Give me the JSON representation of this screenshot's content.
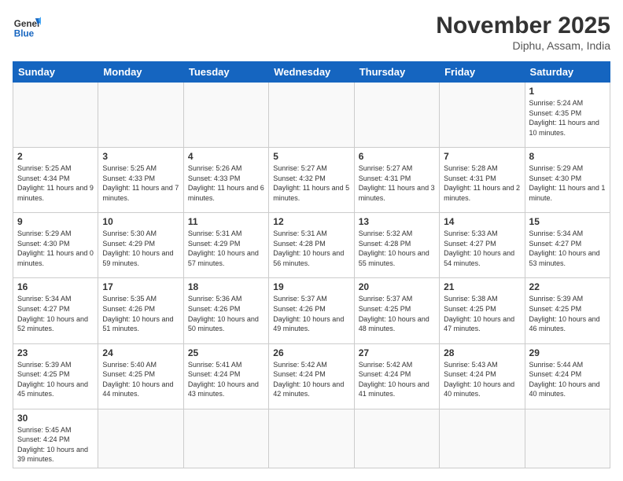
{
  "header": {
    "logo_general": "General",
    "logo_blue": "Blue",
    "month_year": "November 2025",
    "location": "Diphu, Assam, India"
  },
  "weekdays": [
    "Sunday",
    "Monday",
    "Tuesday",
    "Wednesday",
    "Thursday",
    "Friday",
    "Saturday"
  ],
  "weeks": [
    [
      {
        "day": "",
        "info": ""
      },
      {
        "day": "",
        "info": ""
      },
      {
        "day": "",
        "info": ""
      },
      {
        "day": "",
        "info": ""
      },
      {
        "day": "",
        "info": ""
      },
      {
        "day": "",
        "info": ""
      },
      {
        "day": "1",
        "info": "Sunrise: 5:24 AM\nSunset: 4:35 PM\nDaylight: 11 hours and 10 minutes."
      }
    ],
    [
      {
        "day": "2",
        "info": "Sunrise: 5:25 AM\nSunset: 4:34 PM\nDaylight: 11 hours and 9 minutes."
      },
      {
        "day": "3",
        "info": "Sunrise: 5:25 AM\nSunset: 4:33 PM\nDaylight: 11 hours and 7 minutes."
      },
      {
        "day": "4",
        "info": "Sunrise: 5:26 AM\nSunset: 4:33 PM\nDaylight: 11 hours and 6 minutes."
      },
      {
        "day": "5",
        "info": "Sunrise: 5:27 AM\nSunset: 4:32 PM\nDaylight: 11 hours and 5 minutes."
      },
      {
        "day": "6",
        "info": "Sunrise: 5:27 AM\nSunset: 4:31 PM\nDaylight: 11 hours and 3 minutes."
      },
      {
        "day": "7",
        "info": "Sunrise: 5:28 AM\nSunset: 4:31 PM\nDaylight: 11 hours and 2 minutes."
      },
      {
        "day": "8",
        "info": "Sunrise: 5:29 AM\nSunset: 4:30 PM\nDaylight: 11 hours and 1 minute."
      }
    ],
    [
      {
        "day": "9",
        "info": "Sunrise: 5:29 AM\nSunset: 4:30 PM\nDaylight: 11 hours and 0 minutes."
      },
      {
        "day": "10",
        "info": "Sunrise: 5:30 AM\nSunset: 4:29 PM\nDaylight: 10 hours and 59 minutes."
      },
      {
        "day": "11",
        "info": "Sunrise: 5:31 AM\nSunset: 4:29 PM\nDaylight: 10 hours and 57 minutes."
      },
      {
        "day": "12",
        "info": "Sunrise: 5:31 AM\nSunset: 4:28 PM\nDaylight: 10 hours and 56 minutes."
      },
      {
        "day": "13",
        "info": "Sunrise: 5:32 AM\nSunset: 4:28 PM\nDaylight: 10 hours and 55 minutes."
      },
      {
        "day": "14",
        "info": "Sunrise: 5:33 AM\nSunset: 4:27 PM\nDaylight: 10 hours and 54 minutes."
      },
      {
        "day": "15",
        "info": "Sunrise: 5:34 AM\nSunset: 4:27 PM\nDaylight: 10 hours and 53 minutes."
      }
    ],
    [
      {
        "day": "16",
        "info": "Sunrise: 5:34 AM\nSunset: 4:27 PM\nDaylight: 10 hours and 52 minutes."
      },
      {
        "day": "17",
        "info": "Sunrise: 5:35 AM\nSunset: 4:26 PM\nDaylight: 10 hours and 51 minutes."
      },
      {
        "day": "18",
        "info": "Sunrise: 5:36 AM\nSunset: 4:26 PM\nDaylight: 10 hours and 50 minutes."
      },
      {
        "day": "19",
        "info": "Sunrise: 5:37 AM\nSunset: 4:26 PM\nDaylight: 10 hours and 49 minutes."
      },
      {
        "day": "20",
        "info": "Sunrise: 5:37 AM\nSunset: 4:25 PM\nDaylight: 10 hours and 48 minutes."
      },
      {
        "day": "21",
        "info": "Sunrise: 5:38 AM\nSunset: 4:25 PM\nDaylight: 10 hours and 47 minutes."
      },
      {
        "day": "22",
        "info": "Sunrise: 5:39 AM\nSunset: 4:25 PM\nDaylight: 10 hours and 46 minutes."
      }
    ],
    [
      {
        "day": "23",
        "info": "Sunrise: 5:39 AM\nSunset: 4:25 PM\nDaylight: 10 hours and 45 minutes."
      },
      {
        "day": "24",
        "info": "Sunrise: 5:40 AM\nSunset: 4:25 PM\nDaylight: 10 hours and 44 minutes."
      },
      {
        "day": "25",
        "info": "Sunrise: 5:41 AM\nSunset: 4:24 PM\nDaylight: 10 hours and 43 minutes."
      },
      {
        "day": "26",
        "info": "Sunrise: 5:42 AM\nSunset: 4:24 PM\nDaylight: 10 hours and 42 minutes."
      },
      {
        "day": "27",
        "info": "Sunrise: 5:42 AM\nSunset: 4:24 PM\nDaylight: 10 hours and 41 minutes."
      },
      {
        "day": "28",
        "info": "Sunrise: 5:43 AM\nSunset: 4:24 PM\nDaylight: 10 hours and 40 minutes."
      },
      {
        "day": "29",
        "info": "Sunrise: 5:44 AM\nSunset: 4:24 PM\nDaylight: 10 hours and 40 minutes."
      }
    ],
    [
      {
        "day": "30",
        "info": "Sunrise: 5:45 AM\nSunset: 4:24 PM\nDaylight: 10 hours and 39 minutes."
      },
      {
        "day": "",
        "info": ""
      },
      {
        "day": "",
        "info": ""
      },
      {
        "day": "",
        "info": ""
      },
      {
        "day": "",
        "info": ""
      },
      {
        "day": "",
        "info": ""
      },
      {
        "day": "",
        "info": ""
      }
    ]
  ]
}
